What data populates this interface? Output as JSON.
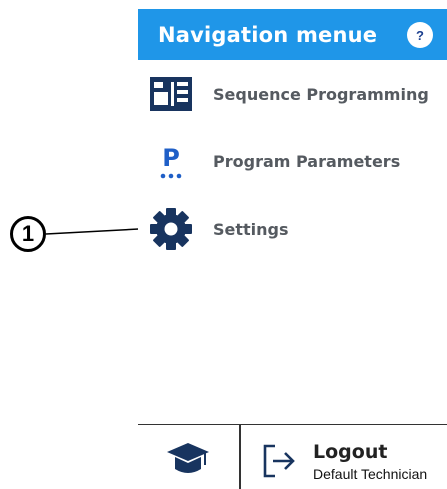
{
  "callout": {
    "number": "1"
  },
  "nav": {
    "title": "Navigation menue",
    "help_label": "?",
    "items": [
      {
        "label": "Sequence Programming",
        "icon": "sequence-icon"
      },
      {
        "label": "Program Parameters",
        "icon": "program-parameters-icon",
        "icon_text": "P"
      },
      {
        "label": "Settings",
        "icon": "gear-icon"
      }
    ]
  },
  "footer": {
    "training_icon": "graduation-cap-icon",
    "logout_label": "Logout",
    "user_label": "Default Technician"
  },
  "colors": {
    "header_bg": "#1f96e8",
    "icon_dark": "#18345f",
    "accent_blue": "#1f5fc7",
    "label_gray": "#555a60"
  }
}
